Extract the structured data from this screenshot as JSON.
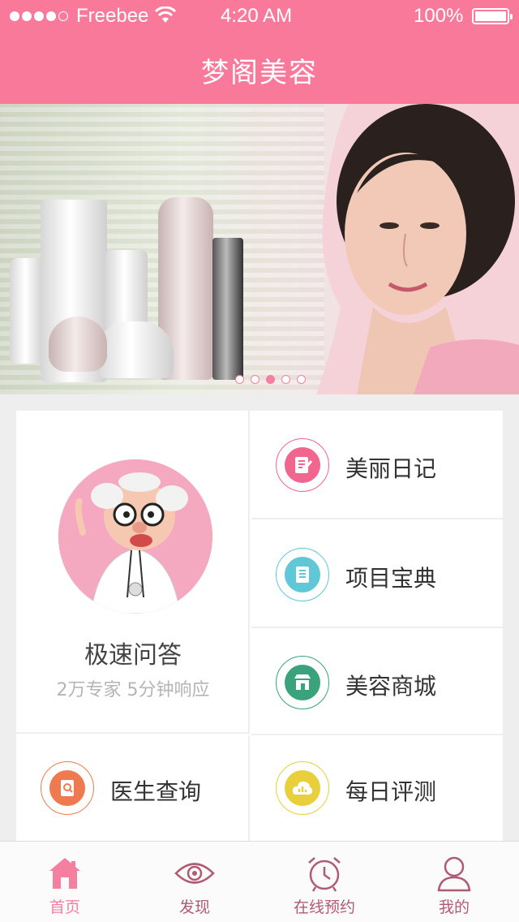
{
  "status_bar": {
    "carrier": "Freebee",
    "time": "4:20 AM",
    "battery": "100%"
  },
  "nav": {
    "title": "梦阁美容"
  },
  "banner": {
    "slide_count": 5,
    "active_slide": 3
  },
  "features": {
    "quick_qa": {
      "title": "极速问答",
      "subtitle": "2万专家 5分钟响应"
    },
    "items": [
      {
        "label": "美丽日记",
        "icon": "diary-icon",
        "color": "#f0668f"
      },
      {
        "label": "项目宝典",
        "icon": "handbook-icon",
        "color": "#5fc7d6"
      },
      {
        "label": "美容商城",
        "icon": "shop-icon",
        "color": "#3aa37c"
      },
      {
        "label": "医生查询",
        "icon": "doctor-search-icon",
        "color": "#f07a4f"
      },
      {
        "label": "每日评测",
        "icon": "daily-test-icon",
        "color": "#e8cf3b"
      }
    ]
  },
  "tabbar": {
    "tabs": [
      {
        "label": "首页",
        "icon": "home-icon",
        "active": true
      },
      {
        "label": "发现",
        "icon": "eye-icon",
        "active": false
      },
      {
        "label": "在线预约",
        "icon": "alarm-clock-icon",
        "active": false
      },
      {
        "label": "我的",
        "icon": "user-icon",
        "active": false
      }
    ]
  },
  "colors": {
    "accent": "#f9799b",
    "tab_active": "#f57fa0",
    "tab_inactive": "#b05b74"
  }
}
